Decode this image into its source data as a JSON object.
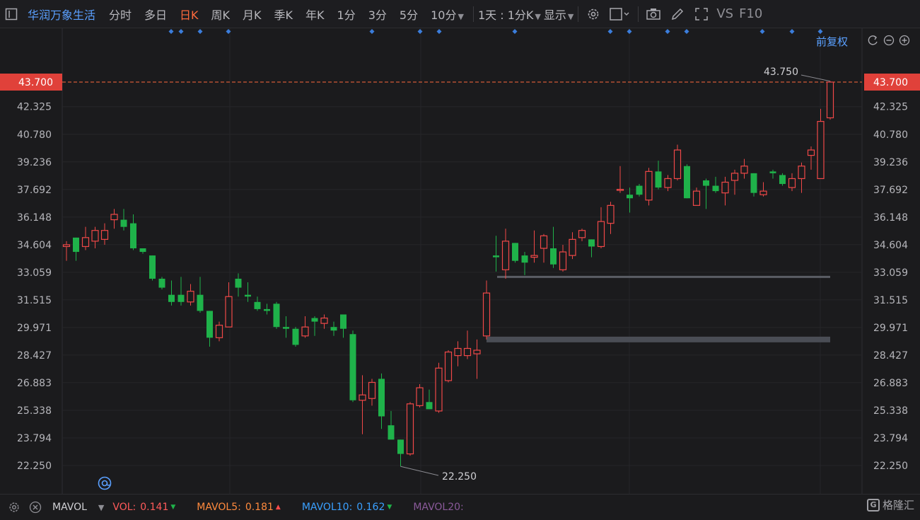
{
  "toolbar": {
    "title": "华润万象生活",
    "periods": [
      "分时",
      "多日",
      "日K",
      "周K",
      "月K",
      "季K",
      "年K",
      "1分",
      "3分",
      "5分",
      "10分"
    ],
    "active_period": "日K",
    "interval": "1天 : 1分K",
    "display": "显示",
    "vs": "VS",
    "f10": "F10"
  },
  "adjust": {
    "label": "前复权"
  },
  "colors": {
    "up": "#f04848",
    "down": "#1fb24a",
    "accent": "#5aa0ff",
    "price_line": "#ff6a3d",
    "price_tag_bg": "#e0413a"
  },
  "current_price": "43.700",
  "high_marker": "43.750",
  "low_marker": "22.250",
  "volume_bar": {
    "name": "MAVOL",
    "items": [
      {
        "key": "VOL:",
        "value": "0.141",
        "color": "#ff5a5a",
        "trend": "down"
      },
      {
        "key": "MAVOL5:",
        "value": "0.181",
        "color": "#ff8a3d",
        "trend": "up"
      },
      {
        "key": "MAVOL10:",
        "value": "0.162",
        "color": "#3aa0ff",
        "trend": "down"
      },
      {
        "key": "MAVOL20:",
        "value": "",
        "color": "#8a5a9a",
        "trend": ""
      }
    ]
  },
  "brand": "格隆汇",
  "chart_data": {
    "type": "candlestick",
    "y_ticks": [
      "43.700",
      "42.325",
      "40.780",
      "39.236",
      "37.692",
      "36.148",
      "34.604",
      "33.059",
      "31.515",
      "29.971",
      "28.427",
      "26.883",
      "25.338",
      "23.794",
      "22.250"
    ],
    "ylim": [
      21.5,
      45.0
    ],
    "reference_lines": [
      32.8,
      29.3
    ],
    "candles": [
      {
        "o": 34.5,
        "h": 34.8,
        "l": 33.7,
        "c": 34.6
      },
      {
        "o": 35.0,
        "h": 35.0,
        "l": 33.7,
        "c": 34.2
      },
      {
        "o": 34.5,
        "h": 35.6,
        "l": 34.3,
        "c": 35.0
      },
      {
        "o": 34.8,
        "h": 35.6,
        "l": 34.4,
        "c": 35.4
      },
      {
        "o": 34.9,
        "h": 35.8,
        "l": 34.6,
        "c": 35.4
      },
      {
        "o": 36.0,
        "h": 36.6,
        "l": 35.5,
        "c": 36.3
      },
      {
        "o": 36.0,
        "h": 36.6,
        "l": 35.4,
        "c": 35.6
      },
      {
        "o": 35.8,
        "h": 36.3,
        "l": 34.3,
        "c": 34.4
      },
      {
        "o": 34.4,
        "h": 34.4,
        "l": 34.1,
        "c": 34.2
      },
      {
        "o": 34.0,
        "h": 34.0,
        "l": 32.6,
        "c": 32.7
      },
      {
        "o": 32.7,
        "h": 32.8,
        "l": 32.1,
        "c": 32.2
      },
      {
        "o": 31.8,
        "h": 32.6,
        "l": 31.2,
        "c": 31.4
      },
      {
        "o": 31.8,
        "h": 32.8,
        "l": 31.2,
        "c": 31.4
      },
      {
        "o": 31.4,
        "h": 32.4,
        "l": 31.2,
        "c": 32.0
      },
      {
        "o": 31.8,
        "h": 32.8,
        "l": 30.8,
        "c": 30.9
      },
      {
        "o": 30.9,
        "h": 30.9,
        "l": 28.9,
        "c": 29.4
      },
      {
        "o": 29.4,
        "h": 30.3,
        "l": 29.2,
        "c": 30.1
      },
      {
        "o": 30.0,
        "h": 32.5,
        "l": 30.0,
        "c": 31.7
      },
      {
        "o": 32.7,
        "h": 33.0,
        "l": 31.7,
        "c": 32.2
      },
      {
        "o": 31.8,
        "h": 32.5,
        "l": 31.4,
        "c": 31.7
      },
      {
        "o": 31.4,
        "h": 31.7,
        "l": 30.9,
        "c": 31.0
      },
      {
        "o": 31.0,
        "h": 31.3,
        "l": 30.7,
        "c": 30.9
      },
      {
        "o": 31.3,
        "h": 31.4,
        "l": 29.9,
        "c": 30.0
      },
      {
        "o": 30.0,
        "h": 30.6,
        "l": 29.4,
        "c": 29.9
      },
      {
        "o": 29.9,
        "h": 30.0,
        "l": 28.9,
        "c": 29.0
      },
      {
        "o": 29.5,
        "h": 30.6,
        "l": 29.4,
        "c": 30.0
      },
      {
        "o": 30.5,
        "h": 30.6,
        "l": 29.5,
        "c": 30.3
      },
      {
        "o": 30.2,
        "h": 30.7,
        "l": 29.9,
        "c": 30.5
      },
      {
        "o": 30.0,
        "h": 30.3,
        "l": 29.5,
        "c": 29.8
      },
      {
        "o": 30.7,
        "h": 30.7,
        "l": 29.4,
        "c": 29.9
      },
      {
        "o": 29.6,
        "h": 29.8,
        "l": 25.8,
        "c": 25.9
      },
      {
        "o": 25.9,
        "h": 27.3,
        "l": 24.0,
        "c": 26.2
      },
      {
        "o": 26.0,
        "h": 27.1,
        "l": 25.6,
        "c": 26.9
      },
      {
        "o": 27.1,
        "h": 27.4,
        "l": 24.3,
        "c": 25.0
      },
      {
        "o": 24.5,
        "h": 25.3,
        "l": 23.8,
        "c": 23.7
      },
      {
        "o": 23.7,
        "h": 23.7,
        "l": 22.2,
        "c": 22.9
      },
      {
        "o": 22.9,
        "h": 25.8,
        "l": 22.8,
        "c": 25.7
      },
      {
        "o": 25.6,
        "h": 26.8,
        "l": 25.5,
        "c": 26.6
      },
      {
        "o": 25.8,
        "h": 26.5,
        "l": 25.4,
        "c": 25.4
      },
      {
        "o": 25.3,
        "h": 28.0,
        "l": 25.2,
        "c": 27.7
      },
      {
        "o": 27.0,
        "h": 28.7,
        "l": 26.9,
        "c": 28.6
      },
      {
        "o": 28.4,
        "h": 29.2,
        "l": 27.8,
        "c": 28.8
      },
      {
        "o": 28.4,
        "h": 29.8,
        "l": 28.2,
        "c": 28.8
      },
      {
        "o": 28.5,
        "h": 29.3,
        "l": 27.1,
        "c": 28.7
      },
      {
        "o": 29.5,
        "h": 32.6,
        "l": 29.3,
        "c": 31.9
      },
      {
        "o": 34.0,
        "h": 35.1,
        "l": 33.1,
        "c": 33.9
      },
      {
        "o": 33.2,
        "h": 35.5,
        "l": 32.7,
        "c": 34.8
      },
      {
        "o": 34.7,
        "h": 34.7,
        "l": 33.6,
        "c": 33.7
      },
      {
        "o": 34.0,
        "h": 34.2,
        "l": 32.9,
        "c": 33.6
      },
      {
        "o": 33.9,
        "h": 35.4,
        "l": 33.6,
        "c": 34.0
      },
      {
        "o": 34.4,
        "h": 35.2,
        "l": 33.6,
        "c": 35.1
      },
      {
        "o": 34.4,
        "h": 35.6,
        "l": 33.3,
        "c": 33.5
      },
      {
        "o": 33.2,
        "h": 34.6,
        "l": 33.1,
        "c": 34.2
      },
      {
        "o": 34.0,
        "h": 35.3,
        "l": 33.8,
        "c": 34.9
      },
      {
        "o": 35.0,
        "h": 35.5,
        "l": 34.8,
        "c": 35.4
      },
      {
        "o": 34.9,
        "h": 34.9,
        "l": 33.9,
        "c": 34.5
      },
      {
        "o": 34.5,
        "h": 36.7,
        "l": 34.4,
        "c": 35.9
      },
      {
        "o": 35.8,
        "h": 37.0,
        "l": 35.2,
        "c": 36.8
      },
      {
        "o": 37.7,
        "h": 39.0,
        "l": 37.5,
        "c": 37.7
      },
      {
        "o": 37.4,
        "h": 37.8,
        "l": 36.4,
        "c": 37.2
      },
      {
        "o": 37.9,
        "h": 38.0,
        "l": 37.3,
        "c": 37.4
      },
      {
        "o": 37.1,
        "h": 38.9,
        "l": 36.8,
        "c": 38.7
      },
      {
        "o": 38.7,
        "h": 39.3,
        "l": 37.7,
        "c": 37.8
      },
      {
        "o": 37.8,
        "h": 38.5,
        "l": 37.6,
        "c": 38.3
      },
      {
        "o": 38.3,
        "h": 40.2,
        "l": 38.2,
        "c": 39.9
      },
      {
        "o": 39.0,
        "h": 39.1,
        "l": 37.2,
        "c": 37.2
      },
      {
        "o": 36.8,
        "h": 37.8,
        "l": 36.8,
        "c": 37.6
      },
      {
        "o": 38.2,
        "h": 38.3,
        "l": 36.6,
        "c": 37.9
      },
      {
        "o": 37.9,
        "h": 38.4,
        "l": 37.5,
        "c": 37.6
      },
      {
        "o": 37.5,
        "h": 38.4,
        "l": 36.8,
        "c": 38.1
      },
      {
        "o": 38.2,
        "h": 38.8,
        "l": 37.4,
        "c": 38.6
      },
      {
        "o": 38.6,
        "h": 39.4,
        "l": 38.3,
        "c": 39.0
      },
      {
        "o": 38.6,
        "h": 38.6,
        "l": 37.3,
        "c": 37.5
      },
      {
        "o": 37.4,
        "h": 38.1,
        "l": 37.3,
        "c": 37.6
      },
      {
        "o": 38.7,
        "h": 38.8,
        "l": 38.3,
        "c": 38.6
      },
      {
        "o": 38.5,
        "h": 38.6,
        "l": 37.9,
        "c": 38.0
      },
      {
        "o": 37.8,
        "h": 38.6,
        "l": 37.6,
        "c": 38.3
      },
      {
        "o": 38.3,
        "h": 39.2,
        "l": 37.5,
        "c": 39.0
      },
      {
        "o": 39.6,
        "h": 40.1,
        "l": 38.8,
        "c": 39.9
      },
      {
        "o": 38.3,
        "h": 42.2,
        "l": 38.3,
        "c": 41.5
      },
      {
        "o": 41.7,
        "h": 43.75,
        "l": 41.6,
        "c": 43.7
      }
    ],
    "event_marker_count": 18
  }
}
